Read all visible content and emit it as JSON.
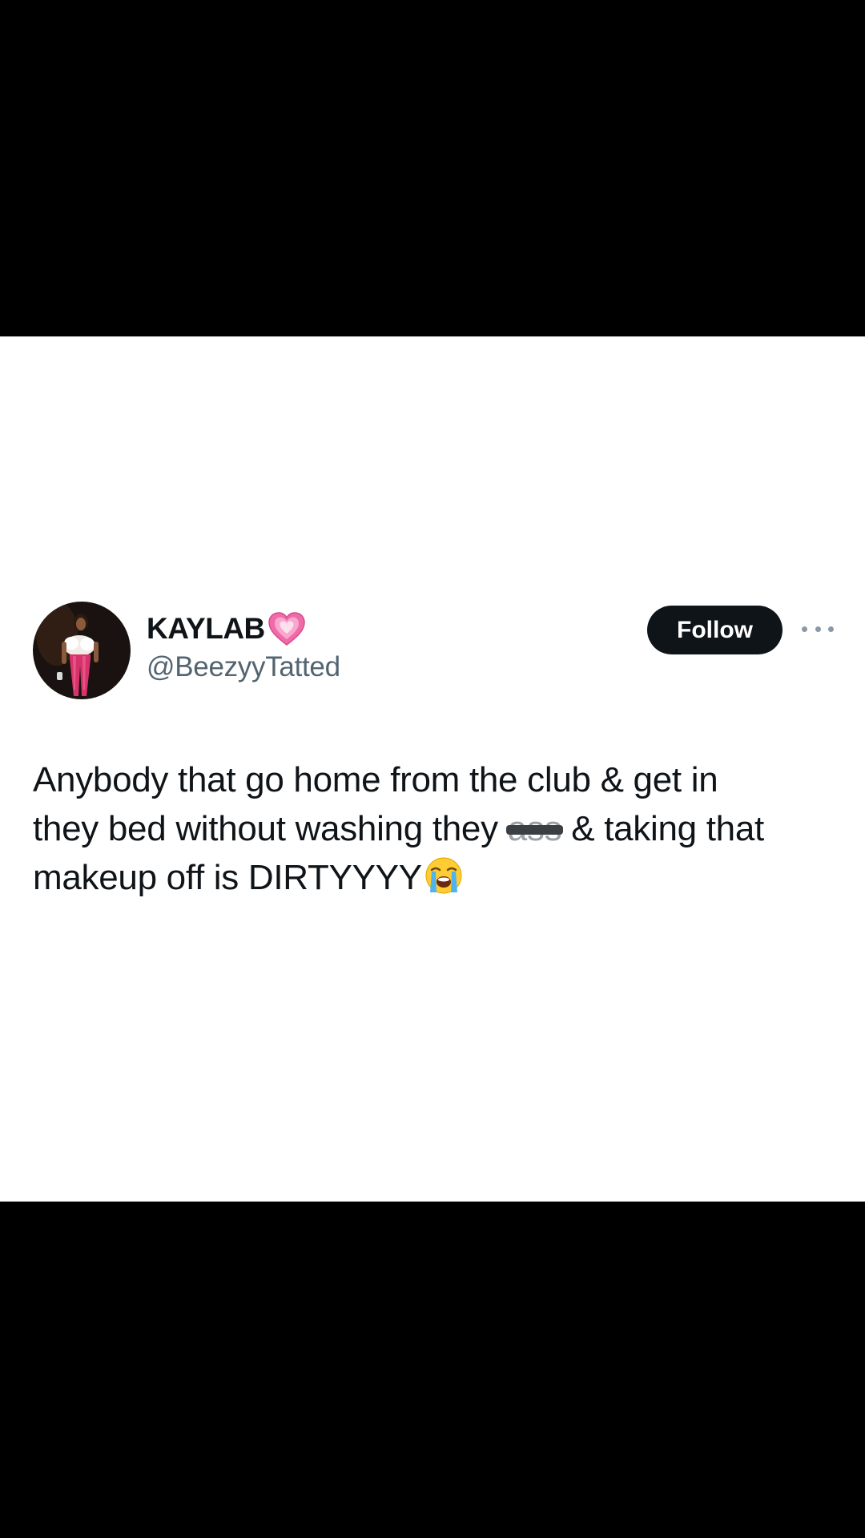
{
  "tweet": {
    "display_name": "KAYLAB",
    "name_emoji": "growing-heart-icon",
    "handle": "@BeezyyTatted",
    "follow_label": "Follow",
    "more_icon": "more-options-icon",
    "text_line1": "Anybody that go home from the club & get in",
    "text_line2_before": "they bed without washing they ",
    "text_censored": "ass",
    "text_line2_after": " & taking that",
    "text_line3": "makeup off is DIRTYYYY",
    "end_emoji": "loudly-crying-face-icon"
  },
  "colors": {
    "background": "#ffffff",
    "letterbox": "#000000",
    "text_primary": "#0f1419",
    "text_secondary": "#536471",
    "follow_button_bg": "#0f1419"
  }
}
